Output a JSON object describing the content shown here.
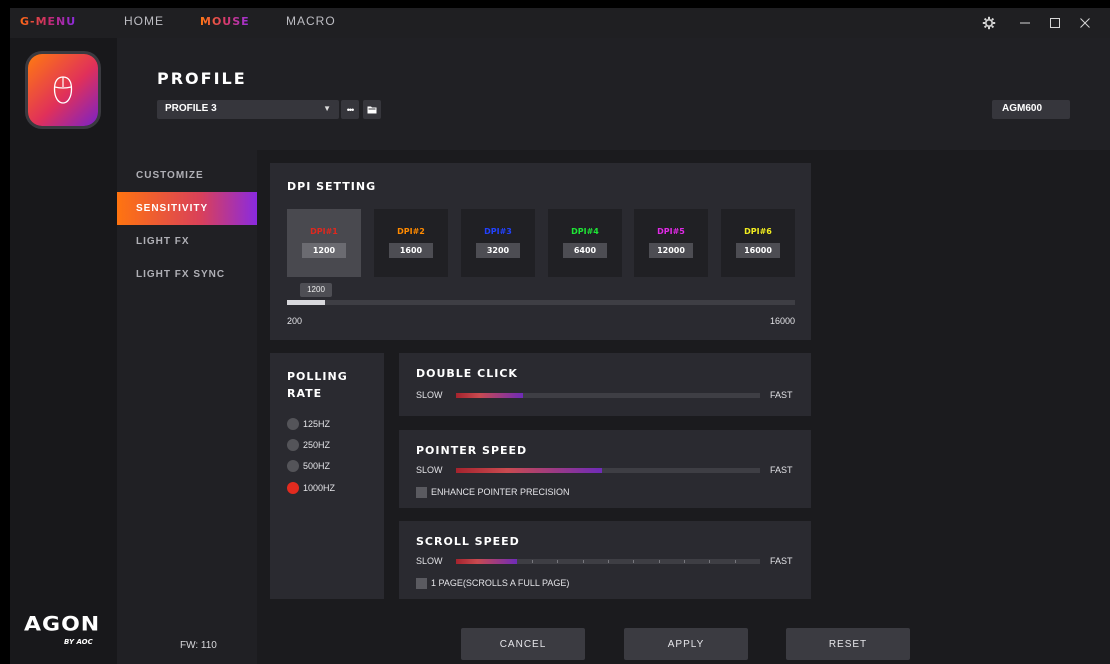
{
  "titlebar": {
    "brand": "G-MENU",
    "tabs": [
      "HOME",
      "MOUSE",
      "MACRO"
    ],
    "active_tab": "MOUSE",
    "window_icons": [
      "settings-icon",
      "minimize-icon",
      "maximize-icon",
      "close-icon"
    ]
  },
  "header": {
    "title": "PROFILE",
    "profile_selected": "PROFILE 3",
    "more_btn": "•••",
    "device": "AGM600"
  },
  "sidebar": {
    "items": [
      {
        "label": "CUSTOMIZE"
      },
      {
        "label": "SENSITIVITY",
        "active": true
      },
      {
        "label": "LIGHT FX"
      },
      {
        "label": "LIGHT FX SYNC"
      }
    ],
    "fw": "FW: 110",
    "logo_main": "AGON",
    "logo_sub": "BY AOC"
  },
  "dpi": {
    "title": "DPI SETTING",
    "levels": [
      {
        "label": "DPI#1",
        "value": "1200",
        "color": "#e0281e",
        "active": true
      },
      {
        "label": "DPI#2",
        "value": "1600",
        "color": "#ff8a00"
      },
      {
        "label": "DPI#3",
        "value": "3200",
        "color": "#2242ff"
      },
      {
        "label": "DPI#4",
        "value": "6400",
        "color": "#1ee636"
      },
      {
        "label": "DPI#5",
        "value": "12000",
        "color": "#e02ae6"
      },
      {
        "label": "DPI#6",
        "value": "16000",
        "color": "#f2ee20"
      }
    ],
    "slider_tooltip": "1200",
    "slider_min": "200",
    "slider_max": "16000",
    "slider_value": 1200
  },
  "polling": {
    "title_line1": "POLLING",
    "title_line2": "RATE",
    "options": [
      {
        "label": "125HZ"
      },
      {
        "label": "250HZ"
      },
      {
        "label": "500HZ"
      },
      {
        "label": "1000HZ",
        "selected": true
      }
    ]
  },
  "double_click": {
    "title": "DOUBLE CLICK",
    "slow": "SLOW",
    "fast": "FAST",
    "fraction": 0.22
  },
  "pointer": {
    "title": "POINTER SPEED",
    "slow": "SLOW",
    "fast": "FAST",
    "fraction": 0.48,
    "checkbox": "ENHANCE POINTER PRECISION"
  },
  "scroll": {
    "title": "SCROLL SPEED",
    "slow": "SLOW",
    "fast": "FAST",
    "fraction": 0.2,
    "checkbox": "1 PAGE(SCROLLS A FULL PAGE)"
  },
  "footer": {
    "cancel": "CANCEL",
    "apply": "APPLY",
    "reset": "RESET"
  }
}
